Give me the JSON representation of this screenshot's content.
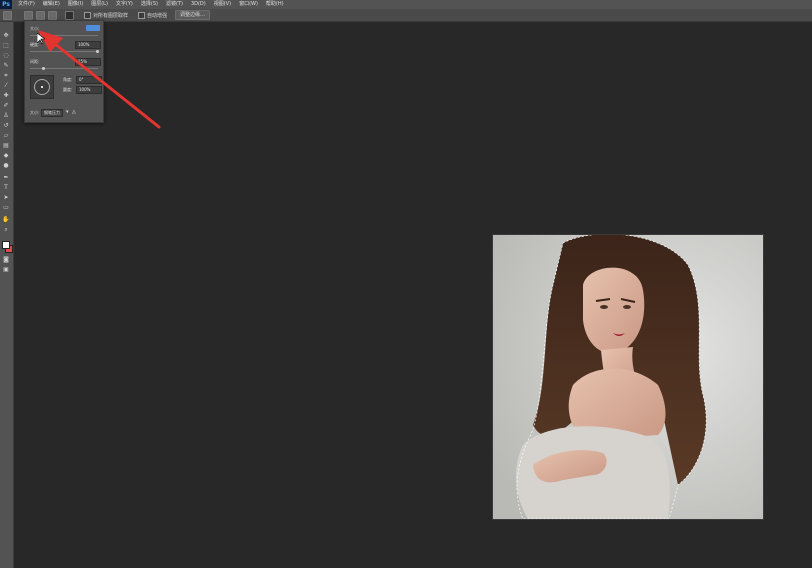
{
  "app": {
    "logo": "Ps"
  },
  "menubar": {
    "items": [
      "文件(F)",
      "编辑(E)",
      "图像(I)",
      "图层(L)",
      "文字(Y)",
      "选择(S)",
      "滤镜(T)",
      "3D(D)",
      "视图(V)",
      "窗口(W)",
      "帮助(H)"
    ]
  },
  "optionsbar": {
    "sample_all_layers": "对所有图层取样",
    "auto_enhance": "自动增强",
    "refine_edge": "调整边缘..."
  },
  "brush_panel": {
    "size_label": "大小:",
    "hardness_label": "硬度:",
    "hardness_value": "100%",
    "spacing_label": "间距:",
    "spacing_value": "25%",
    "angle_label": "角度:",
    "angle_value": "0°",
    "roundness_label": "圆度:",
    "roundness_value": "100%",
    "size_footer_label": "大小:",
    "size_footer_value": "钢笔压力"
  },
  "colors": {
    "accent": "#4f8edc",
    "arrow": "#e3352f",
    "foreground_swatch": "#ffffff",
    "background_swatch": "#e14b4b"
  },
  "canvas": {
    "content": "photo-portrait-woman-off-shoulder-sweater-with-selection"
  }
}
